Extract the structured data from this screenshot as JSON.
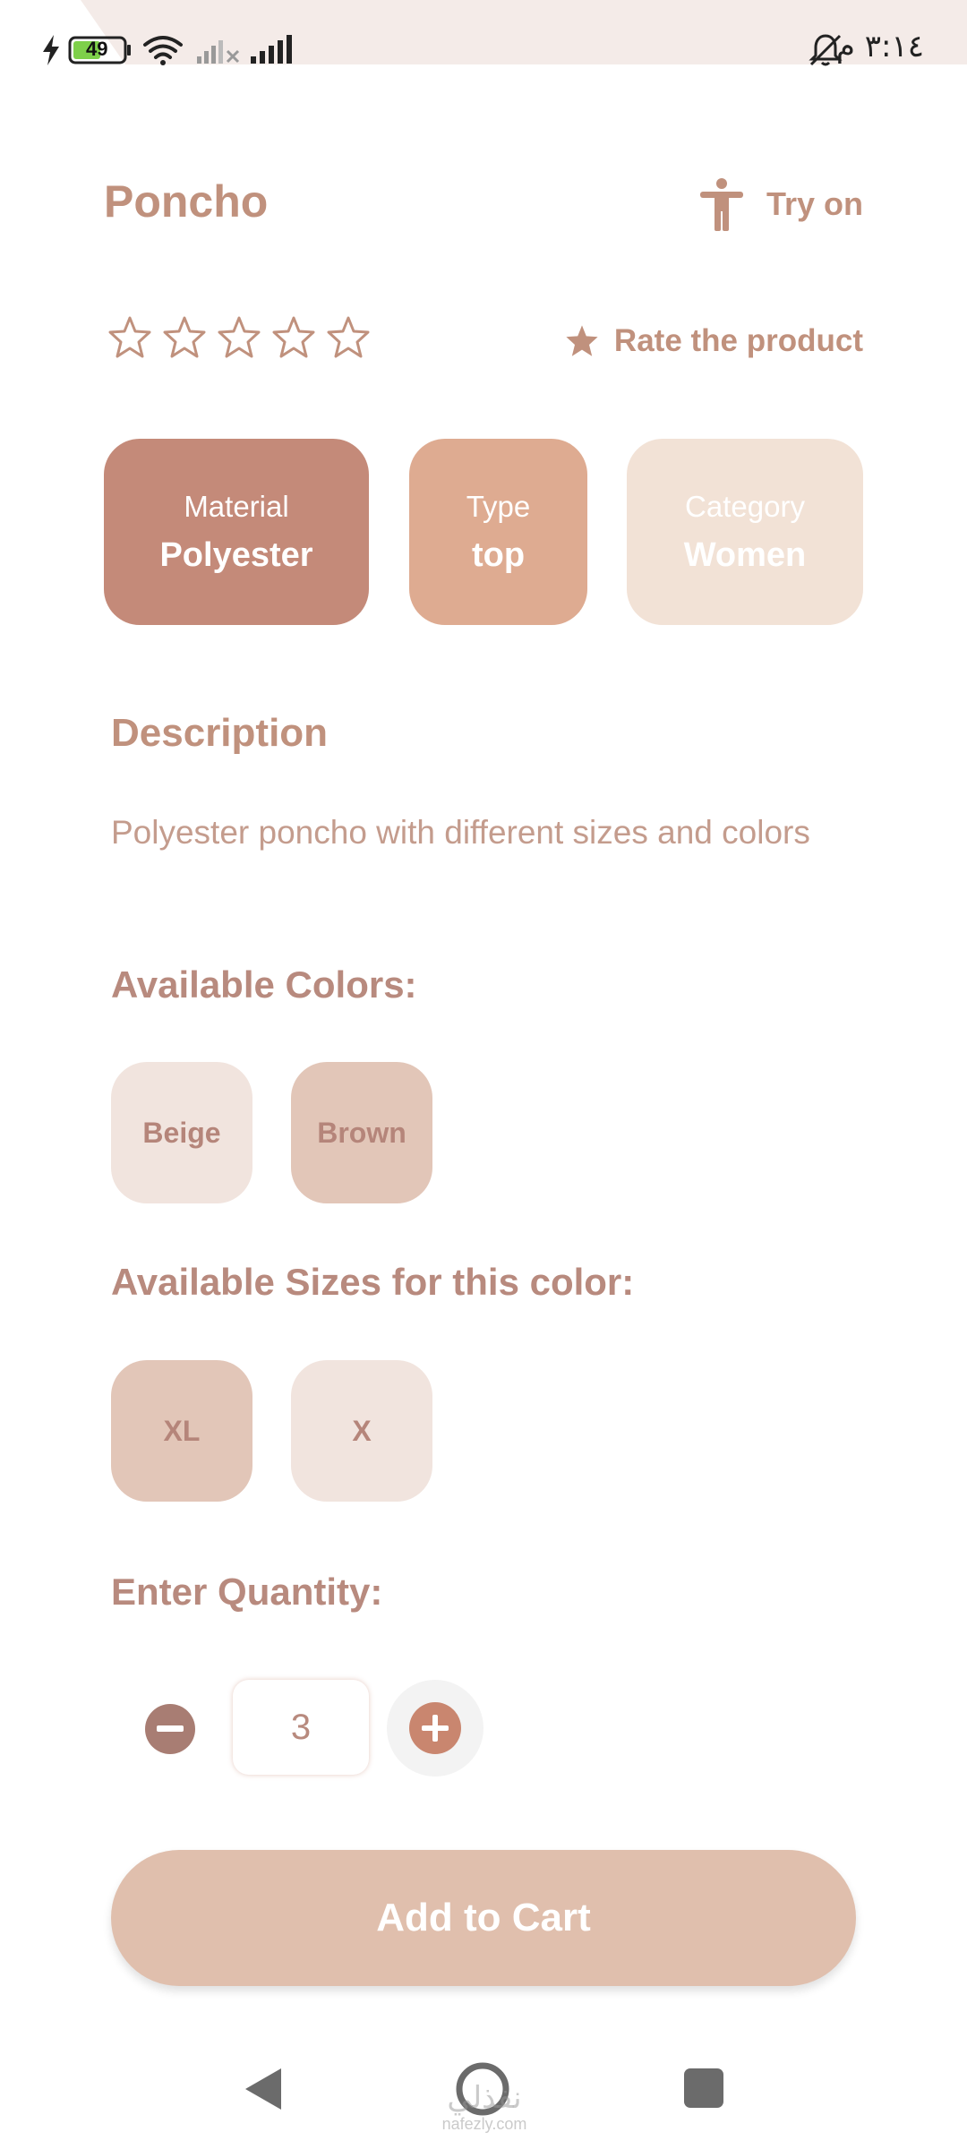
{
  "status_bar": {
    "battery": "49",
    "clock": "٣:١٤ م"
  },
  "product": {
    "title": "Poncho",
    "try_on_label": "Try on",
    "rating": {
      "value": 0,
      "max": 5
    },
    "rate_label": "Rate the product"
  },
  "attributes": {
    "material": {
      "label": "Material",
      "value": "Polyester"
    },
    "type": {
      "label": "Type",
      "value": "top"
    },
    "category": {
      "label": "Category",
      "value": "Women"
    }
  },
  "description": {
    "heading": "Description",
    "text": "Polyester poncho with different sizes and colors"
  },
  "colors": {
    "heading": "Available Colors:",
    "options": [
      "Beige",
      "Brown"
    ],
    "selected": "Brown"
  },
  "sizes": {
    "heading": "Available Sizes for this color:",
    "options": [
      "XL",
      "X"
    ],
    "selected": "XL"
  },
  "quantity": {
    "heading": "Enter Quantity:",
    "value": "3"
  },
  "cta": {
    "label": "Add to Cart"
  },
  "watermark": {
    "arabic": "نفذلي",
    "latin": "nafezly.com"
  },
  "icons": {
    "try_on": "person-icon",
    "rate": "star-filled-icon",
    "rating_star": "star-outline-icon",
    "minus": "minus-circle-icon",
    "plus": "plus-circle-icon"
  },
  "colors_theme": {
    "accent": "#c0917d",
    "material_card": "#c48a79",
    "type_card": "#deab91",
    "category_card": "#f2e2d6",
    "cta": "#e0bfad"
  }
}
